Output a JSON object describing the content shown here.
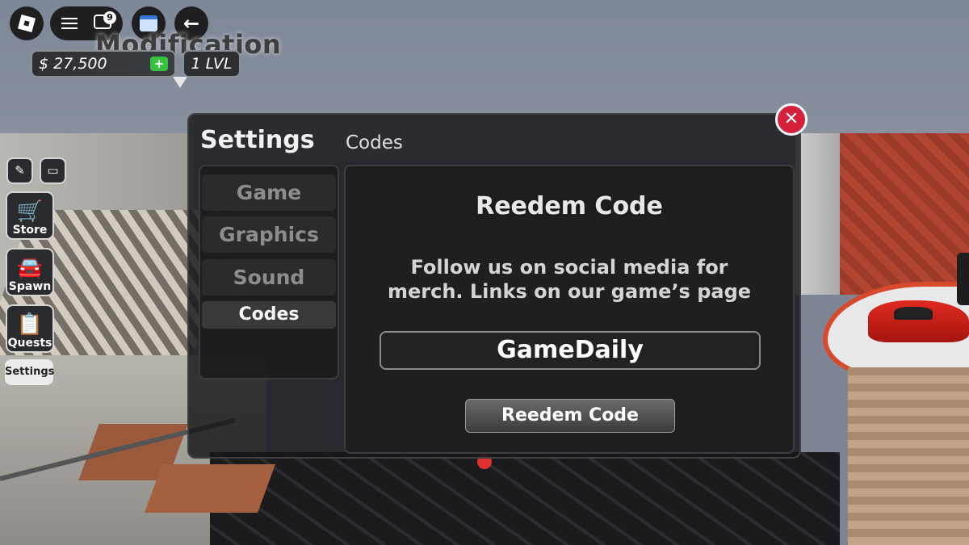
{
  "hud": {
    "notification_count": "9",
    "title": "Modification",
    "money": "$ 27,500",
    "add_label": "+",
    "level": "1 LVL"
  },
  "sidebar": {
    "buttons": [
      {
        "label": "Store",
        "icon": "cart-icon"
      },
      {
        "label": "Spawn",
        "icon": "car-icon"
      },
      {
        "label": "Quests",
        "icon": "clipboard-icon"
      }
    ],
    "settings_label": "Settings"
  },
  "settings": {
    "title": "Settings",
    "section": "Codes",
    "close_label": "✕",
    "tabs": [
      "Game",
      "Graphics",
      "Sound",
      "Codes"
    ],
    "active_tab": "Codes",
    "panel": {
      "heading": "Reedem Code",
      "description": "Follow us on social media for merch. Links on our game’s page",
      "code_value": "GameDaily",
      "button_label": "Reedem Code"
    }
  },
  "colors": {
    "close_button": "#d51f3b",
    "add_money": "#37c140"
  }
}
